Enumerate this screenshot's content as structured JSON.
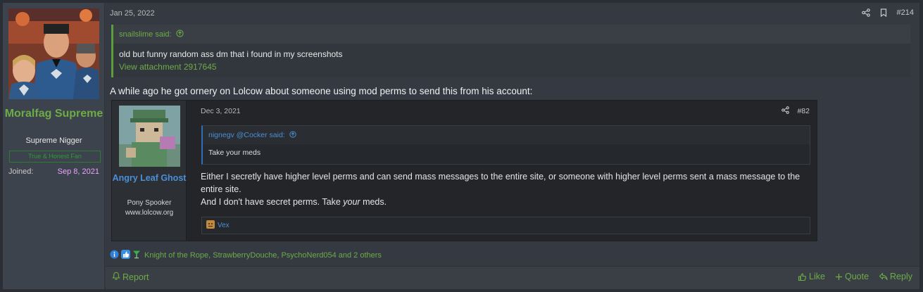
{
  "author": {
    "name": "Moralfag Supreme",
    "title": "Supreme Nigger",
    "banner": "True & Honest Fan",
    "joined_label": "Joined:",
    "joined_value": "Sep 8, 2021"
  },
  "post": {
    "date": "Jan 25, 2022",
    "number": "#214",
    "quote": {
      "author_said": "snailslime said:",
      "text": "old but funny random ass dm that i found in my screenshots",
      "link": "View attachment 2917645"
    },
    "text": "A while ago he got ornery on Lolcow about someone using mod perms to send this from his account:"
  },
  "embed": {
    "author": "Angry Leaf Ghost",
    "title": "Pony Spooker",
    "site": "www.lolcow.org",
    "date": "Dec 3, 2021",
    "number": "#82",
    "quote_author": "nignegv @Cocker said:",
    "quote_text": "Take your meds",
    "body_line1": "Either I secretly have higher level perms and can send mass messages to the entire site, or someone with higher level perms sent a mass message to the entire site.",
    "body_line2_pre": "And I don't have secret perms. Take ",
    "body_line2_em": "your",
    "body_line2_post": " meds.",
    "reaction_user": "Vex"
  },
  "reactions": {
    "text": "Knight of the Rope, StrawberryDouche, PsychoNerd054 and 2 others"
  },
  "footer": {
    "report": "Report",
    "like": "Like",
    "quote": "Quote",
    "reply": "Reply"
  }
}
